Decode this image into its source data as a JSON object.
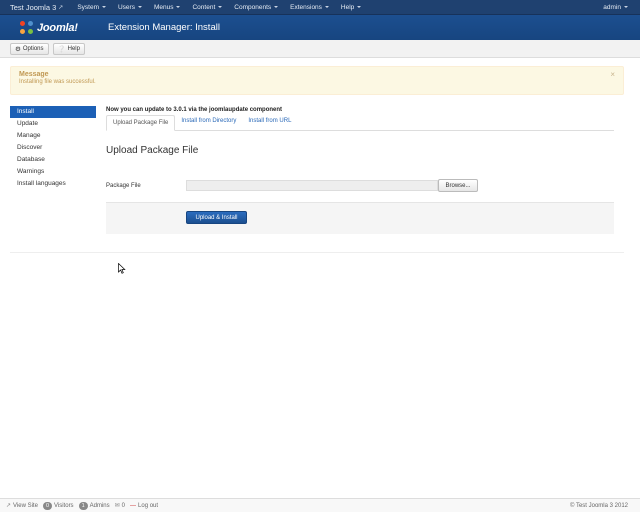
{
  "navbar": {
    "site_name": "Test Joomla 3",
    "site_ext_icon": "external-link-icon",
    "menus": [
      "System",
      "Users",
      "Menus",
      "Content",
      "Components",
      "Extensions",
      "Help"
    ],
    "user": "admin"
  },
  "header": {
    "logo_text": "Joomla!",
    "title": "Extension Manager: Install"
  },
  "toolbar": {
    "options_label": "Options",
    "help_label": "Help"
  },
  "message": {
    "title": "Message",
    "text": "Installing file was successful.",
    "close": "×"
  },
  "sidebar": {
    "items": [
      {
        "label": "Install",
        "active": true
      },
      {
        "label": "Update"
      },
      {
        "label": "Manage"
      },
      {
        "label": "Discover"
      },
      {
        "label": "Database"
      },
      {
        "label": "Warnings"
      },
      {
        "label": "Install languages"
      }
    ]
  },
  "main": {
    "update_notice": "Now you can update to 3.0.1 via the joomlaupdate component",
    "tabs": [
      {
        "label": "Upload Package File",
        "active": true
      },
      {
        "label": "Install from Directory"
      },
      {
        "label": "Install from URL"
      }
    ],
    "section_title": "Upload Package File",
    "package_label": "Package File",
    "browse_label": "Browse...",
    "submit_label": "Upload & Install"
  },
  "statusbar": {
    "view_site": "View Site",
    "visitors_count": "0",
    "visitors_label": "Visitors",
    "admins_count": "1",
    "admins_label": "Admins",
    "messages_count": "0",
    "logout": "Log out",
    "copyright": "© Test Joomla 3 2012"
  },
  "colors": {
    "navbar": "#1f4170",
    "header": "#1c4f90",
    "accent": "#1c60b6",
    "message_bg": "#fcf8e3",
    "message_text": "#c09853"
  }
}
